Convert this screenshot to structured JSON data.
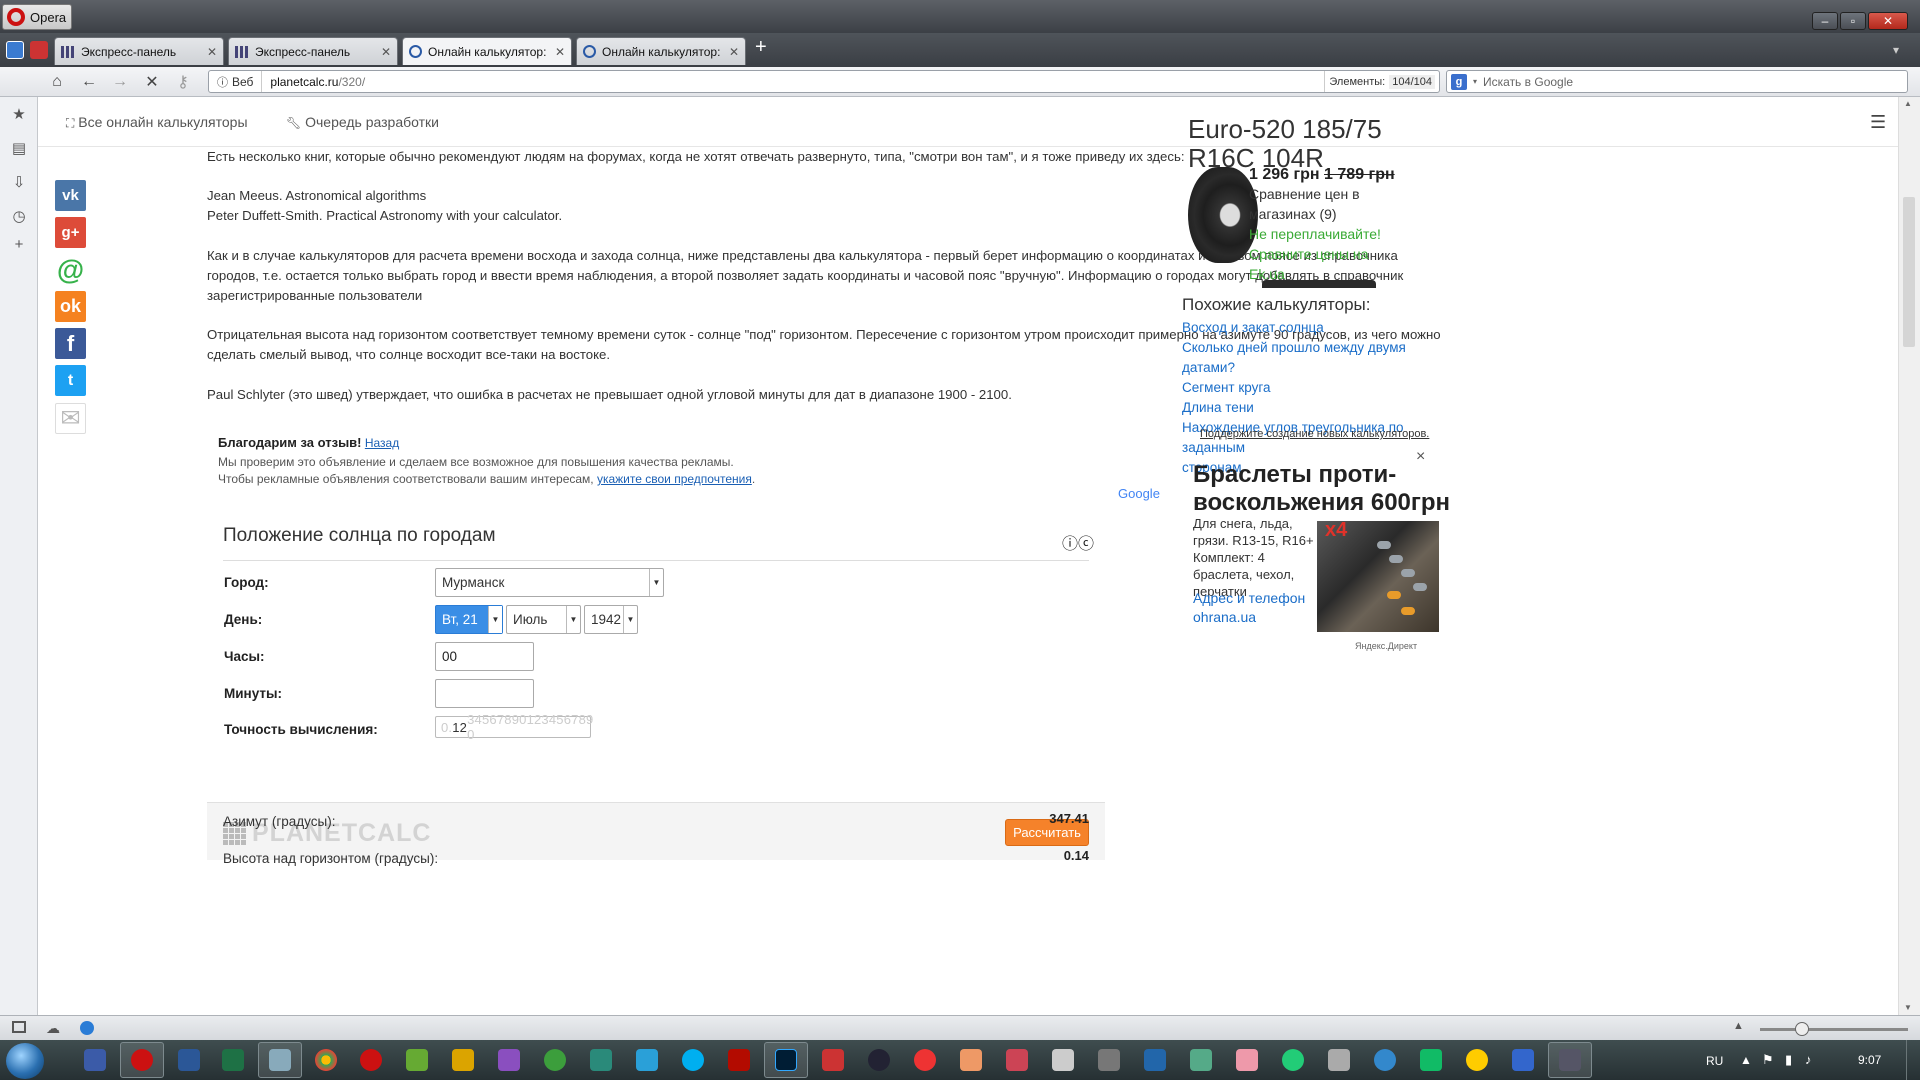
{
  "browser": {
    "app_name": "Opera",
    "tabs": [
      {
        "label": "Экспресс-панель"
      },
      {
        "label": "Экспресс-панель"
      },
      {
        "label": "Онлайн калькулятор: ..."
      },
      {
        "label": "Онлайн калькулятор: ..."
      }
    ],
    "address": {
      "web_label": "Веб",
      "domain": "planetcalc.ru",
      "path": "/320/",
      "elements_label": "Элементы:",
      "elements_value": "104/104"
    },
    "search": {
      "placeholder": "Искать в Google"
    }
  },
  "site_nav": {
    "all_calculators": "Все онлайн калькуляторы",
    "dev_queue": "Очередь разработки"
  },
  "social": [
    "vk",
    "google-plus",
    "mail-ru",
    "odnoklassniki",
    "facebook",
    "twitter",
    "email"
  ],
  "article": {
    "p1": "Есть несколько книг, которые обычно рекомендуют людям на форумах, когда не хотят отвечать развернуто, типа, \"смотри вон там\", и я тоже приведу их здесь:",
    "book1": "Jean Meeus. Astronomical algorithms",
    "book2": "Peter Duffett-Smith. Practical Astronomy with your calculator.",
    "p2": "Как и в случае калькуляторов для расчета времени восхода и захода солнца, ниже представлены два калькулятора - первый берет информацию о координатах и часовом поясе из справочника городов, т.е. остается только выбрать город и ввести время наблюдения, а второй позволяет задать координаты и часовой пояс \"вручную\". Информацию о городах могут добавлять в справочник зарегистрированные пользователи",
    "p3": "Отрицательная высота над горизонтом соответствует темному времени суток - солнце \"под\" горизонтом. Пересечение с горизонтом утром происходит примерно на азимуте 90 градусов, из чего можно сделать смелый вывод, что солнце восходит все-таки на востоке.",
    "p4": "Paul Schlyter (это швед) утверждает, что ошибка в расчетах не превышает одной угловой минуты для дат в диапазоне 1900 - 2100."
  },
  "ad_feedback": {
    "thanks": "Благодарим за отзыв!",
    "back": "Назад",
    "line1": "Мы проверим это объявление и сделаем все возможное для повышения качества рекламы.",
    "line2": "Чтобы рекламные объявления соответствовали вашим интересам,",
    "prefs_link": "укажите свои предпочтения",
    "dot": ".",
    "google": "Google"
  },
  "calculator": {
    "title": "Положение солнца по городам",
    "city_label": "Город:",
    "city_value": "Мурманск",
    "day_label": "День:",
    "day_value": "Вт, 21",
    "month_value": "Июль",
    "year_value": "1942",
    "hours_label": "Часы:",
    "hours_value": "00",
    "minutes_label": "Минуты:",
    "minutes_value": "",
    "precision_label": "Точность вычисления:",
    "precision_prefix": "0.",
    "precision_digits": "12",
    "precision_rest": "34567890123456789 0",
    "brand": "PLANETCALC",
    "calc_button": "Рассчитать",
    "azimuth_label": "Азимут (градусы):",
    "azimuth_value": "347.41",
    "altitude_label": "Высота над горизонтом (градусы):",
    "altitude_value": "0.14"
  },
  "right_ad": {
    "title_line1": "Euro-520 185/75",
    "title_line2": "R16C 104R",
    "price": "1 296 грн",
    "old_price": "1 789 грн",
    "compare_line1": "Сравнение цен в",
    "compare_line2": "магазинах (9)",
    "green1": "Не переплачивайте!",
    "green2": "Сравните цены на",
    "green3": "Ek.ua"
  },
  "similar": {
    "title": "Похожие калькуляторы:",
    "links": [
      "Восход и закат солнца",
      "Сколько дней прошло между двумя датами?",
      "Сегмент круга",
      "Длина тени",
      "Нахождение углов треугольника по заданным",
      "сторонам"
    ],
    "support": "Поддержите создание новых калькуляторов."
  },
  "ad2": {
    "title_line1": "Браслеты проти-",
    "title_line2": "воскольжения 600грн",
    "text": [
      "Для снега, льда,",
      "грязи. R13-15, R16+",
      "Комплект: 4",
      "браслета, чехол,",
      "перчатки"
    ],
    "badge": "x4",
    "link1": "Адрес и телефон",
    "link2": "ohrana.ua",
    "close": "×",
    "yandex": "Яндекс.Директ"
  },
  "taskbar": {
    "lang": "RU",
    "time": "9:07"
  }
}
